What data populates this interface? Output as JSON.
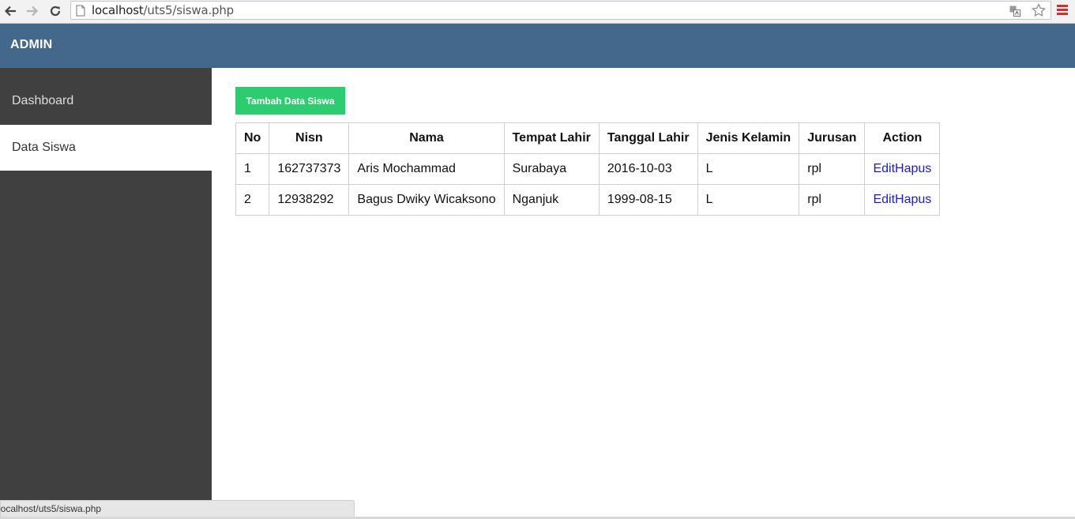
{
  "browser": {
    "url_host": "localhost",
    "url_path": "/uts5/siswa.php"
  },
  "header": {
    "title": "ADMIN"
  },
  "sidebar": {
    "items": [
      {
        "label": "Dashboard",
        "active": false
      },
      {
        "label": "Data Siswa",
        "active": true
      }
    ]
  },
  "main": {
    "add_button_label": "Tambah Data Siswa",
    "table": {
      "columns": [
        "No",
        "Nisn",
        "Nama",
        "Tempat Lahir",
        "Tanggal Lahir",
        "Jenis Kelamin",
        "Jurusan",
        "Action"
      ],
      "rows": [
        {
          "no": "1",
          "nisn": "162737373",
          "nama": "Aris Mochammad",
          "tempat_lahir": "Surabaya",
          "tanggal_lahir": "2016-10-03",
          "jenis_kelamin": "L",
          "jurusan": "rpl",
          "edit": "Edit",
          "hapus": "Hapus"
        },
        {
          "no": "2",
          "nisn": "12938292",
          "nama": "Bagus Dwiky Wicaksono",
          "tempat_lahir": "Nganjuk",
          "tanggal_lahir": "1999-08-15",
          "jenis_kelamin": "L",
          "jurusan": "rpl",
          "edit": "Edit",
          "hapus": "Hapus"
        }
      ]
    }
  },
  "status_bar": {
    "text": "localhost/uts5/siswa.php"
  },
  "colors": {
    "header_bg": "#44678c",
    "sidebar_bg": "#404040",
    "add_button_bg": "#2ecc71",
    "link": "#1a1acc"
  },
  "icons": [
    "back-arrow-icon",
    "forward-arrow-icon",
    "reload-icon",
    "page-icon",
    "translate-icon",
    "star-icon",
    "menu-icon"
  ]
}
